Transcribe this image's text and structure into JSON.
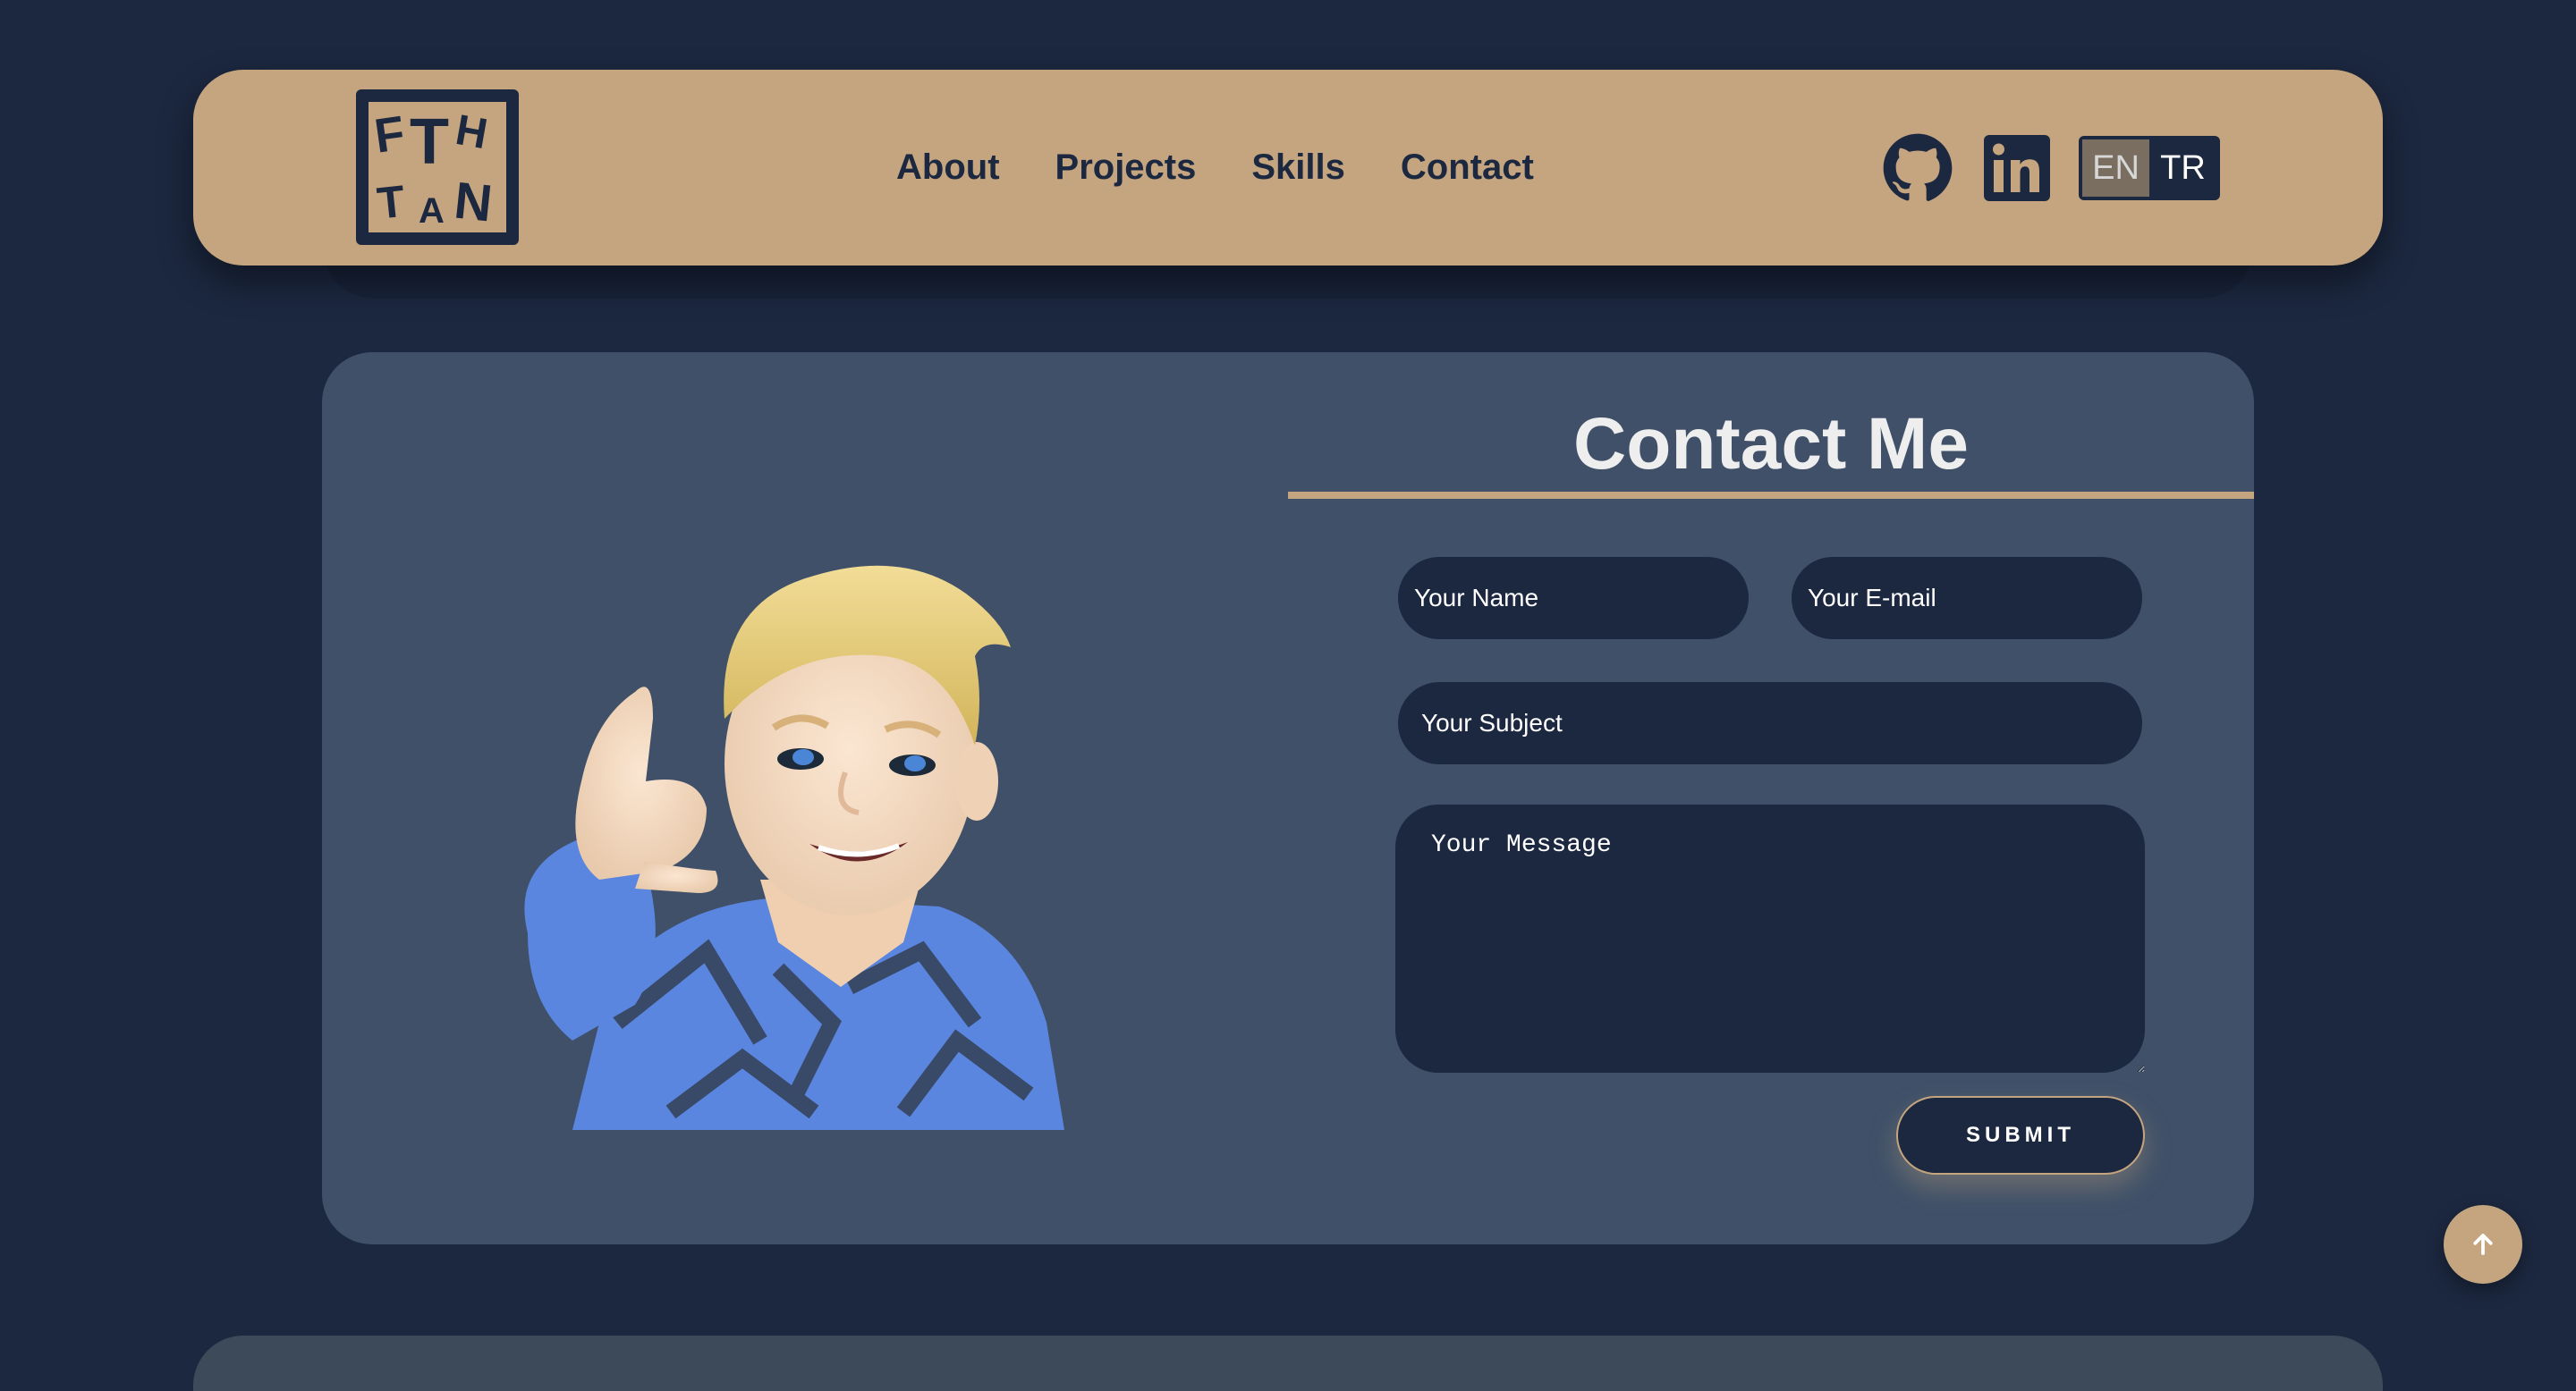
{
  "logo": {
    "alt": "FTH TAN",
    "line1": "FTH",
    "line2": "TAN"
  },
  "nav": {
    "links": [
      {
        "label": "About"
      },
      {
        "label": "Projects"
      },
      {
        "label": "Skills"
      },
      {
        "label": "Contact"
      }
    ],
    "social": [
      {
        "icon": "github-icon"
      },
      {
        "icon": "linkedin-icon"
      }
    ],
    "language": {
      "options": [
        "EN",
        "TR"
      ],
      "selected": "EN"
    }
  },
  "contact": {
    "title": "Contact Me",
    "name_placeholder": "Your Name",
    "email_placeholder": "Your E-mail",
    "subject_placeholder": "Your Subject",
    "message_placeholder": "Your Message",
    "submit_label": "SUBMIT",
    "avatar": "memoji-avatar"
  },
  "back_to_top": {
    "icon": "arrow-up-icon"
  },
  "colors": {
    "background": "#1c2840",
    "accent": "#c4a57f",
    "card": "#3f5068",
    "input": "#1c2840"
  }
}
